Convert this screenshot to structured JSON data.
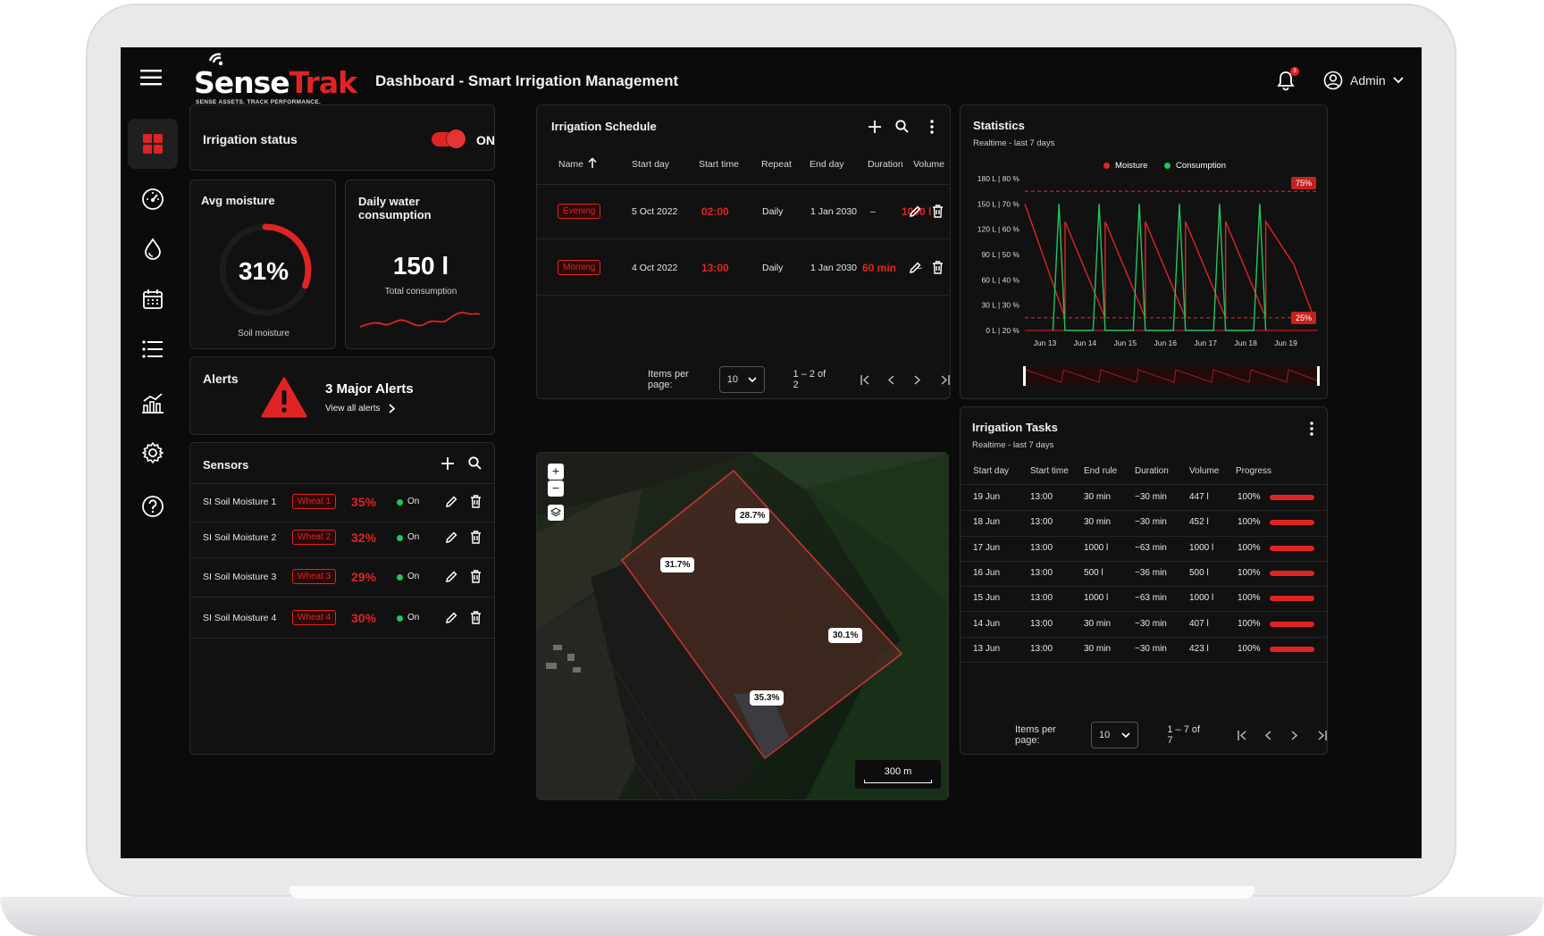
{
  "header": {
    "logo_name": "SenseTrak",
    "logo_part1": "Sense",
    "logo_part2": "Trak",
    "logo_tagline": "SENSE ASSETS. TRACK PERFORMANCE.",
    "title": "Dashboard - Smart Irrigation Management",
    "notification_count": "3",
    "user": "Admin"
  },
  "sidebar": {
    "items": [
      {
        "icon": "dashboard-icon",
        "active": true
      },
      {
        "icon": "gauge-icon"
      },
      {
        "icon": "water-drop-icon"
      },
      {
        "icon": "calendar-icon"
      },
      {
        "icon": "list-icon"
      },
      {
        "icon": "analytics-icon"
      },
      {
        "icon": "settings-icon"
      },
      {
        "icon": "help-icon"
      }
    ]
  },
  "irrigation_status": {
    "label": "Irrigation status",
    "state": "ON",
    "on": true
  },
  "avg_moisture": {
    "title": "Avg moisture",
    "value": "31%",
    "value_fraction": 0.31,
    "caption": "Soil moisture"
  },
  "water": {
    "title": "Daily water consumption",
    "value": "150 l",
    "caption": "Total consumption"
  },
  "alerts": {
    "title": "Alerts",
    "count_text": "3 Major Alerts",
    "link": "View all alerts"
  },
  "sensors": {
    "title": "Sensors",
    "rows": [
      {
        "name": "SI Soil Moisture 1",
        "tag": "Wheat 1",
        "value": "35%",
        "status": "On"
      },
      {
        "name": "SI Soil Moisture 2",
        "tag": "Wheat 2",
        "value": "32%",
        "status": "On"
      },
      {
        "name": "SI Soil Moisture 3",
        "tag": "Wheat 3",
        "value": "29%",
        "status": "On"
      },
      {
        "name": "SI Soil Moisture 4",
        "tag": "Wheat 4",
        "value": "30%",
        "status": "On"
      }
    ]
  },
  "schedule": {
    "title": "Irrigation Schedule",
    "columns": [
      "Name",
      "Start day",
      "Start time",
      "Repeat",
      "End day",
      "Duration",
      "Volume"
    ],
    "rows": [
      {
        "name": "Evening",
        "start_day": "5 Oct 2022",
        "start_time": "02:00",
        "repeat": "Daily",
        "end_day": "1 Jan 2030",
        "duration": "–",
        "volume": "1000 l"
      },
      {
        "name": "Morning",
        "start_day": "4 Oct 2022",
        "start_time": "13:00",
        "repeat": "Daily",
        "end_day": "1 Jan 2030",
        "duration": "60 min",
        "volume": "–"
      }
    ],
    "items_per_page_label": "Items per page:",
    "items_per_page": "10",
    "range": "1 – 2 of 2"
  },
  "map": {
    "zoom_in": "+",
    "zoom_out": "−",
    "labels": [
      "28.7%",
      "31.7%",
      "30.1%",
      "35.3%"
    ],
    "scale": "300 m"
  },
  "statistics": {
    "title": "Statistics",
    "subtitle": "Realtime - last 7 days",
    "legend": [
      "Moisture",
      "Consumption"
    ],
    "high_marker": "75%",
    "low_marker": "25%"
  },
  "chart_data": {
    "type": "line",
    "title": "Statistics",
    "x": [
      "Jun 13",
      "Jun 14",
      "Jun 15",
      "Jun 16",
      "Jun 17",
      "Jun 18",
      "Jun 19"
    ],
    "y_ticks": [
      "180 L | 80 %",
      "150 L | 70 %",
      "120 L | 60 %",
      "90 L | 50 %",
      "60 L | 40 %",
      "30 L | 30 %",
      "0 L | 20 %"
    ],
    "ylim_moisture": [
      20,
      80
    ],
    "ylim_consumption": [
      0,
      180
    ],
    "thresholds": [
      75,
      25
    ],
    "series": [
      {
        "name": "Moisture",
        "color": "#e02424",
        "points": [
          [
            12.5,
            70
          ],
          [
            13.5,
            25
          ],
          [
            13.5,
            63
          ],
          [
            14.5,
            25
          ],
          [
            14.5,
            63
          ],
          [
            15.5,
            25
          ],
          [
            15.5,
            63
          ],
          [
            16.5,
            25
          ],
          [
            16.5,
            63
          ],
          [
            17.5,
            25
          ],
          [
            17.5,
            63
          ],
          [
            18.5,
            25
          ],
          [
            18.5,
            63
          ],
          [
            19.2,
            46
          ],
          [
            19.7,
            25
          ]
        ]
      },
      {
        "name": "Consumption",
        "color": "#22c55e",
        "points": [
          [
            13.2,
            0
          ],
          [
            13.35,
            150
          ],
          [
            13.5,
            0
          ],
          [
            14.2,
            0
          ],
          [
            14.35,
            150
          ],
          [
            14.5,
            0
          ],
          [
            15.2,
            0
          ],
          [
            15.35,
            150
          ],
          [
            15.5,
            0
          ],
          [
            16.2,
            0
          ],
          [
            16.35,
            150
          ],
          [
            16.5,
            0
          ],
          [
            17.2,
            0
          ],
          [
            17.35,
            150
          ],
          [
            17.5,
            0
          ],
          [
            18.2,
            0
          ],
          [
            18.35,
            150
          ],
          [
            18.5,
            0
          ]
        ]
      }
    ],
    "grid": false,
    "legend_position": "top"
  },
  "tasks": {
    "title": "Irrigation Tasks",
    "subtitle": "Realtime - last 7 days",
    "columns": [
      "Start day",
      "Start time",
      "End rule",
      "Duration",
      "Volume",
      "Progress"
    ],
    "rows": [
      {
        "day": "19 Jun",
        "time": "13:00",
        "rule": "30 min",
        "duration": "~30 min",
        "volume": "447 l",
        "progress": "100%",
        "progress_value": 1
      },
      {
        "day": "18 Jun",
        "time": "13:00",
        "rule": "30 min",
        "duration": "~30 min",
        "volume": "452 l",
        "progress": "100%",
        "progress_value": 1
      },
      {
        "day": "17 Jun",
        "time": "13:00",
        "rule": "1000 l",
        "duration": "~63 min",
        "volume": "1000 l",
        "progress": "100%",
        "progress_value": 1
      },
      {
        "day": "16 Jun",
        "time": "13:00",
        "rule": "500 l",
        "duration": "~36 min",
        "volume": "500 l",
        "progress": "100%",
        "progress_value": 1
      },
      {
        "day": "15 Jun",
        "time": "13:00",
        "rule": "1000 l",
        "duration": "~63 min",
        "volume": "1000 l",
        "progress": "100%",
        "progress_value": 1
      },
      {
        "day": "14 Jun",
        "time": "13:00",
        "rule": "30 min",
        "duration": "~30 min",
        "volume": "407 l",
        "progress": "100%",
        "progress_value": 1
      },
      {
        "day": "13 Jun",
        "time": "13:00",
        "rule": "30 min",
        "duration": "~30 min",
        "volume": "423 l",
        "progress": "100%",
        "progress_value": 1
      }
    ],
    "items_per_page_label": "Items per page:",
    "items_per_page": "10",
    "range": "1 – 7 of 7"
  },
  "colors": {
    "accent": "#e02424",
    "background": "#0b0b0b",
    "card": "#111111",
    "success": "#22c55e"
  }
}
